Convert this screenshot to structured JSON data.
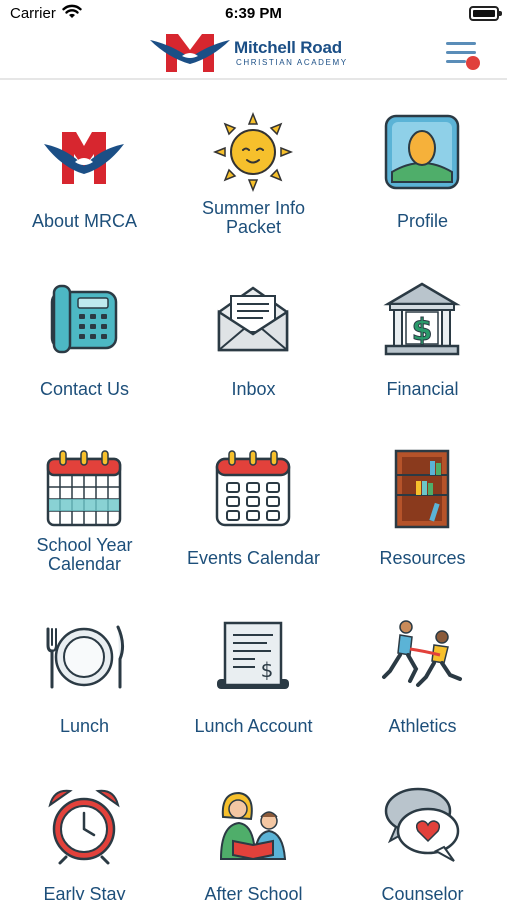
{
  "status_bar": {
    "carrier": "Carrier",
    "time": "6:39 PM"
  },
  "header": {
    "logo_letter": "M",
    "school_name": "Mitchell Road",
    "school_subtitle": "CHRISTIAN ACADEMY"
  },
  "tiles": [
    {
      "label": "About MRCA",
      "icon": "mrca-logo-icon"
    },
    {
      "label": "Summer Info Packet",
      "label_lines": [
        "Summer Info",
        "Packet"
      ],
      "icon": "sun-icon"
    },
    {
      "label": "Profile",
      "icon": "profile-icon"
    },
    {
      "label": "Contact Us",
      "icon": "phone-icon"
    },
    {
      "label": "Inbox",
      "icon": "envelope-icon"
    },
    {
      "label": "Financial",
      "icon": "bank-icon"
    },
    {
      "label": "School Year Calendar",
      "label_lines": [
        "School Year",
        "Calendar"
      ],
      "icon": "calendar-icon"
    },
    {
      "label": "Events Calendar",
      "icon": "events-calendar-icon"
    },
    {
      "label": "Resources",
      "icon": "bookshelf-icon"
    },
    {
      "label": "Lunch",
      "icon": "plate-icon"
    },
    {
      "label": "Lunch Account",
      "icon": "receipt-icon"
    },
    {
      "label": "Athletics",
      "icon": "runners-icon"
    },
    {
      "label": "Early Stay",
      "icon": "alarm-clock-icon"
    },
    {
      "label": "After School",
      "icon": "reading-family-icon"
    },
    {
      "label": "Counselor",
      "icon": "heart-speech-icon"
    }
  ],
  "colors": {
    "brand_red": "#d7262f",
    "brand_blue": "#1b4f86",
    "label_blue": "#1d4f7a",
    "notification": "#e0403c"
  }
}
